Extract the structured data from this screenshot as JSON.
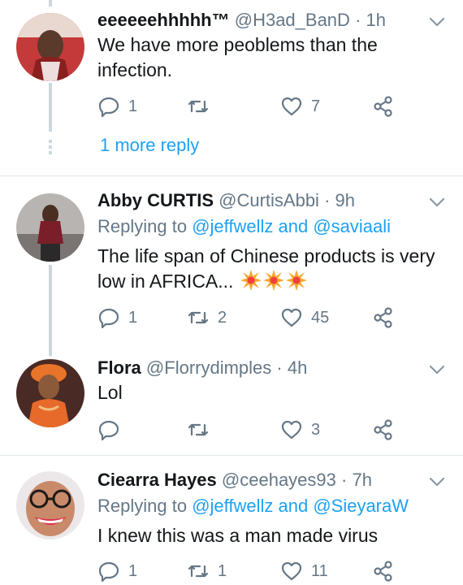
{
  "tweets": [
    {
      "name": "eeeeeehhhhh™",
      "handle": "@H3ad_BanD",
      "time": "· 1h",
      "body": "We have more peoblems than the infection.",
      "replies": "1",
      "retweets": "",
      "likes": "7"
    },
    {
      "name": "Abby CURTIS",
      "handle": "@CurtisAbbi",
      "time": "· 9h",
      "replying_prefix": "Replying to",
      "replying_mention": "@jeffwellz and @saviaali",
      "body": "The life span of Chinese products is very low in AFRICA...",
      "emoji_icon": "collision-emoji-icon",
      "replies": "1",
      "retweets": "2",
      "likes": "45"
    },
    {
      "name": "Flora",
      "handle": "@Florrydimples",
      "time": "· 4h",
      "body": "Lol",
      "replies": "",
      "retweets": "",
      "likes": "3"
    },
    {
      "name": "Ciearra Hayes",
      "handle": "@ceehayes93",
      "time": "· 7h",
      "replying_prefix": "Replying to",
      "replying_mention": "@jeffwellz and @SieyaraW",
      "body": "I knew this was a man made virus",
      "replies": "1",
      "retweets": "1",
      "likes": "11"
    }
  ],
  "more_replies": "1 more reply",
  "colors": {
    "accent": "#1da1f2",
    "secondary_text": "#657786",
    "divider": "#e1e8ed"
  }
}
